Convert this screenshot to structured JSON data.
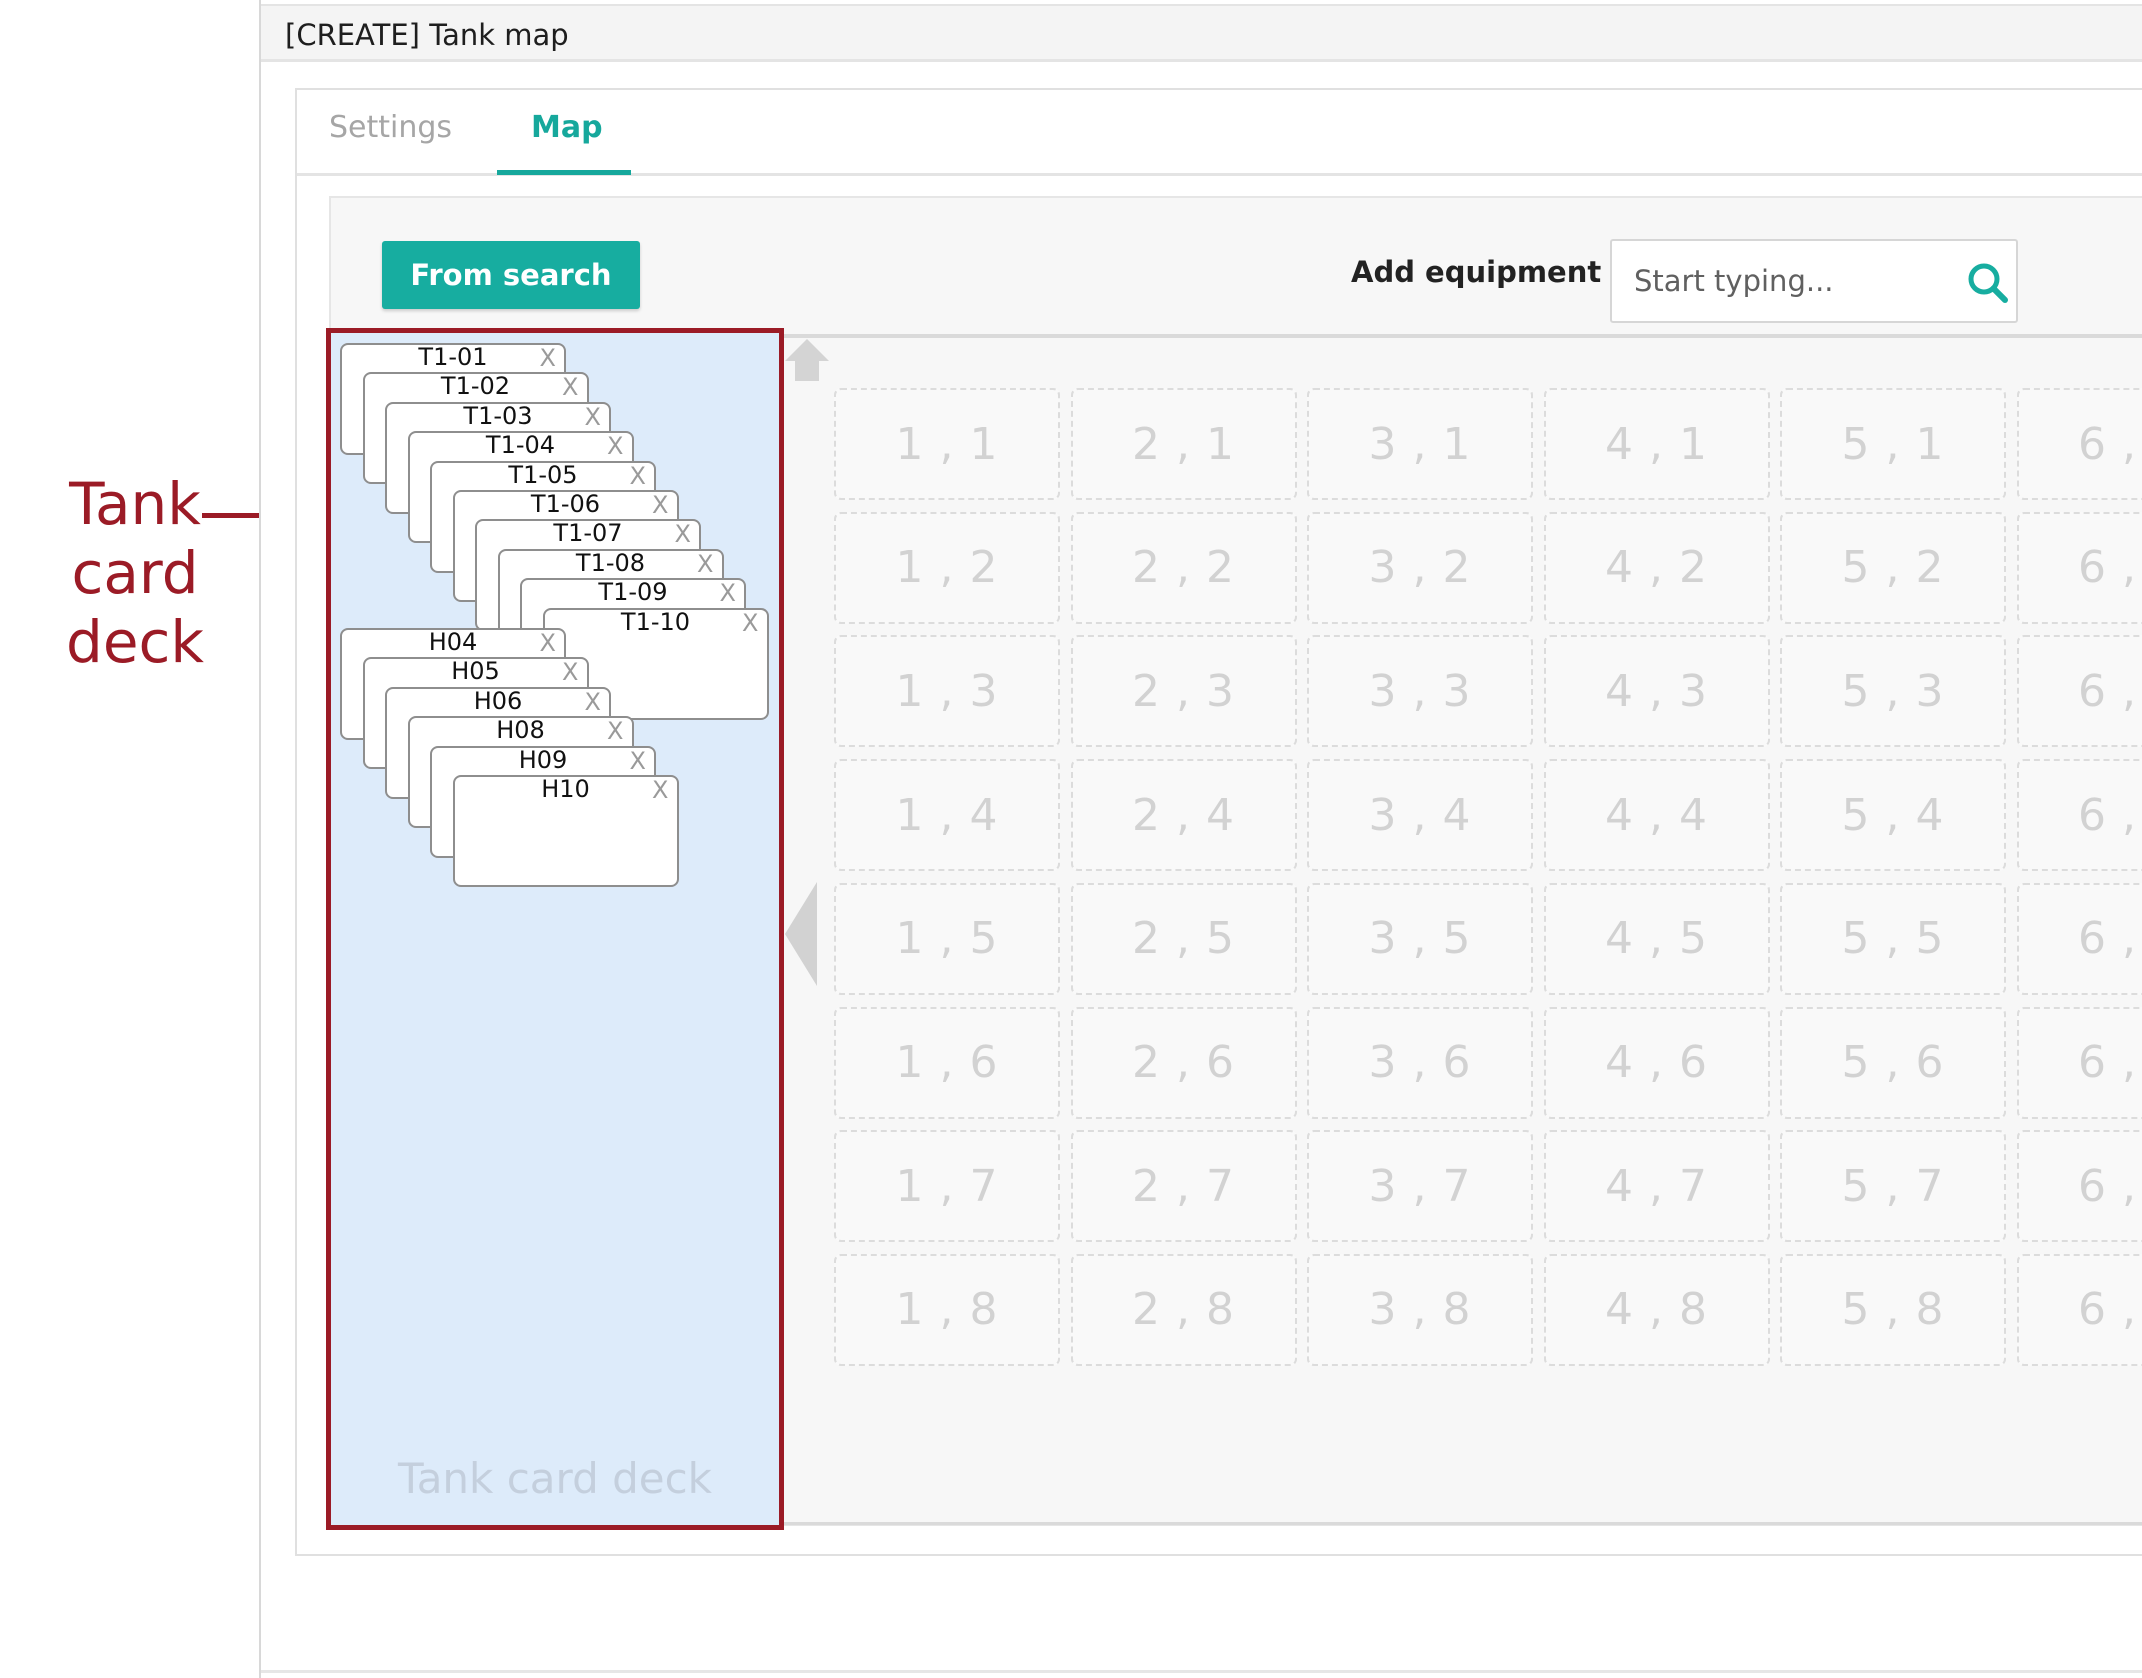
{
  "annotation": {
    "label": "Tank card deck",
    "lines": [
      "Tank",
      "card",
      "deck"
    ],
    "color": "#9b1b26"
  },
  "window": {
    "title": "[CREATE] Tank map"
  },
  "tabs": [
    {
      "label": "Settings",
      "active": false
    },
    {
      "label": "Map",
      "active": true
    }
  ],
  "toolbar": {
    "from_search_label": "From search",
    "add_equipment_label": "Add equipment",
    "search_placeholder": "Start typing...",
    "search_icon": "search-icon"
  },
  "deck": {
    "label": "Tank card deck",
    "close_glyph": "X",
    "groups": [
      {
        "cards": [
          "T1-01",
          "T1-02",
          "T1-03",
          "T1-04",
          "T1-05",
          "T1-06",
          "T1-07",
          "T1-08",
          "T1-09",
          "T1-10"
        ]
      },
      {
        "cards": [
          "H04",
          "H05",
          "H06",
          "H08",
          "H09",
          "H10"
        ]
      }
    ]
  },
  "grid": {
    "columns": [
      "1",
      "2",
      "3",
      "4",
      "5",
      "6"
    ],
    "rows": [
      "1",
      "2",
      "3",
      "4",
      "5",
      "6",
      "7",
      "8"
    ],
    "separator": ","
  },
  "colors": {
    "accent": "#17ada0",
    "deck_background": "#ddebfa",
    "annotation": "#9b1b26"
  }
}
